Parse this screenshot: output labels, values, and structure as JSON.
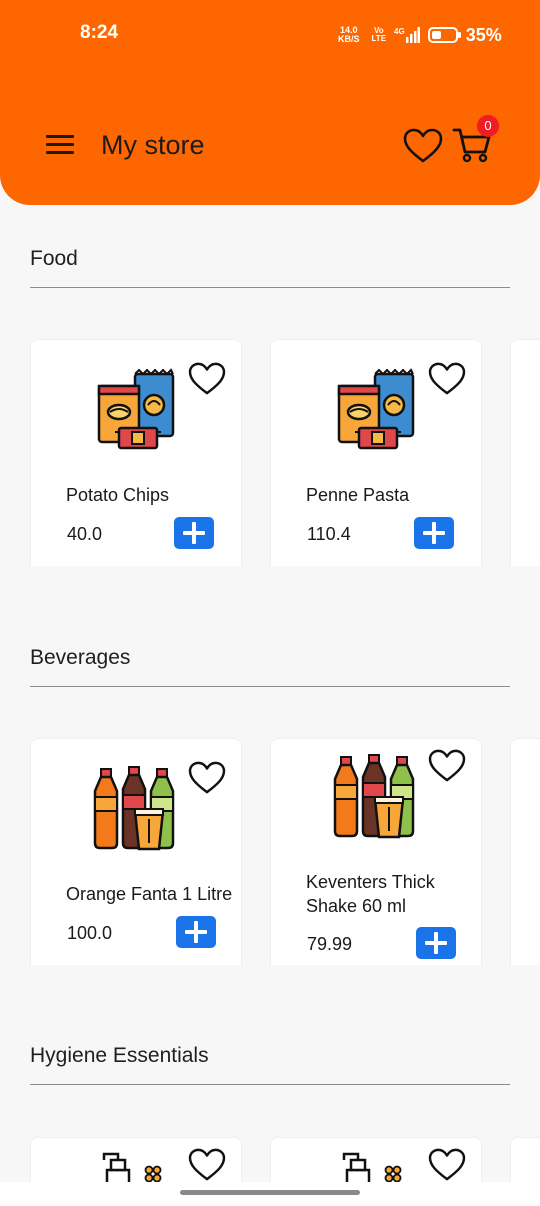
{
  "status_bar": {
    "time": "8:24",
    "net_speed_value": "14.0",
    "net_speed_unit": "KB/S",
    "net_label_top": "Vo",
    "net_label_bottom": "LTE",
    "network_type": "4G",
    "battery": "35%"
  },
  "header": {
    "title": "My store",
    "cart_count": "0",
    "accent": "#fe6700"
  },
  "sections": [
    {
      "title": "Food",
      "products": [
        {
          "name": "Potato Chips",
          "price": "40.0",
          "icon": "snacks-icon"
        },
        {
          "name": "Penne Pasta",
          "price": "110.4",
          "icon": "snacks-icon"
        }
      ]
    },
    {
      "title": "Beverages",
      "products": [
        {
          "name": "Orange Fanta 1 Litre",
          "price": "100.0",
          "icon": "soda-bottles-icon"
        },
        {
          "name": "Keventers Thick Shake 60 ml",
          "price": "79.99",
          "icon": "soda-bottles-icon"
        }
      ]
    },
    {
      "title": "Hygiene Essentials",
      "products": [
        {
          "name": "",
          "price": "",
          "icon": "soap-dispenser-icon"
        },
        {
          "name": "",
          "price": "",
          "icon": "soap-dispenser-icon"
        }
      ]
    }
  ],
  "colors": {
    "add_button": "#1a73e8",
    "badge": "#ee1c25"
  }
}
